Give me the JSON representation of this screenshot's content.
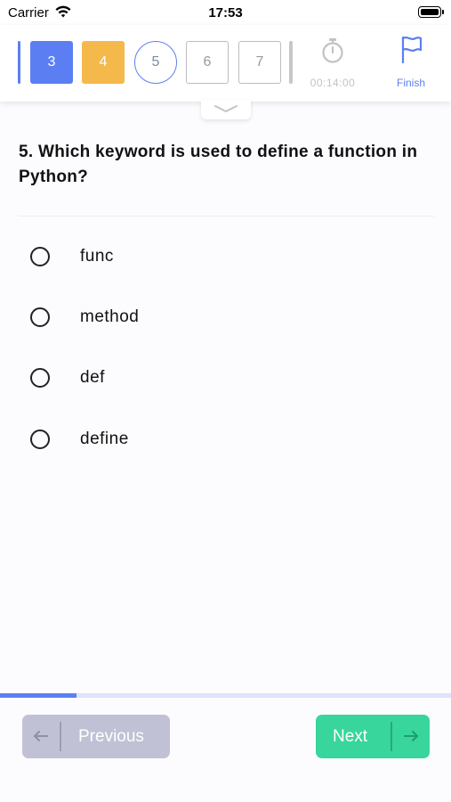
{
  "status": {
    "carrier": "Carrier",
    "time": "17:53"
  },
  "nav": {
    "questions": [
      {
        "label": "3",
        "state": "answered"
      },
      {
        "label": "4",
        "state": "flagged"
      },
      {
        "label": "5",
        "state": "current"
      },
      {
        "label": "6",
        "state": "todo"
      },
      {
        "label": "7",
        "state": "todo"
      }
    ],
    "timer": "00:14:00",
    "finish_label": "Finish",
    "colors": {
      "accent": "#5b7ff2",
      "flagged": "#f5b84b",
      "next": "#38d69c"
    }
  },
  "question": {
    "text": "5. Which keyword is used to define a function in Python?",
    "options": [
      {
        "label": "func",
        "selected": false
      },
      {
        "label": "method",
        "selected": false
      },
      {
        "label": "def",
        "selected": false
      },
      {
        "label": "define",
        "selected": false
      }
    ]
  },
  "progress": {
    "fraction": 0.17
  },
  "footer": {
    "previous_label": "Previous",
    "next_label": "Next"
  }
}
